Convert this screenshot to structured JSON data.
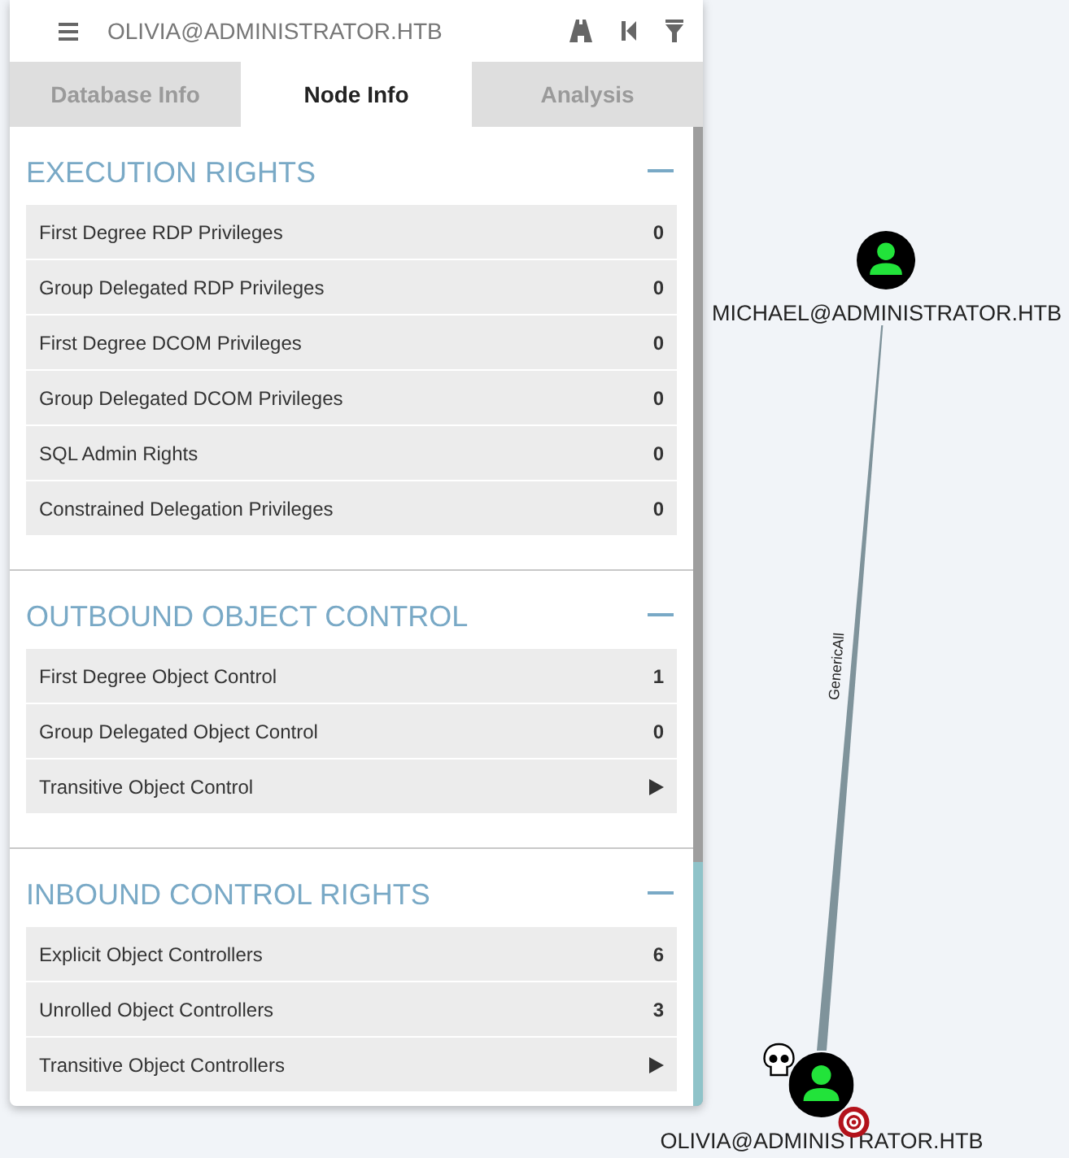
{
  "header": {
    "title": "OLIVIA@ADMINISTRATOR.HTB"
  },
  "tabs": [
    {
      "label": "Database Info",
      "selected": false
    },
    {
      "label": "Node Info",
      "selected": true
    },
    {
      "label": "Analysis",
      "selected": false
    }
  ],
  "sections": [
    {
      "title": "EXECUTION RIGHTS",
      "expanded": true,
      "rows": [
        {
          "kind": "count",
          "label": "First Degree RDP Privileges",
          "value": "0"
        },
        {
          "kind": "count",
          "label": "Group Delegated RDP Privileges",
          "value": "0"
        },
        {
          "kind": "count",
          "label": "First Degree DCOM Privileges",
          "value": "0"
        },
        {
          "kind": "count",
          "label": "Group Delegated DCOM Privileges",
          "value": "0"
        },
        {
          "kind": "count",
          "label": "SQL Admin Rights",
          "value": "0"
        },
        {
          "kind": "count",
          "label": "Constrained Delegation Privileges",
          "value": "0"
        }
      ]
    },
    {
      "title": "OUTBOUND OBJECT CONTROL",
      "expanded": true,
      "rows": [
        {
          "kind": "count",
          "label": "First Degree Object Control",
          "value": "1"
        },
        {
          "kind": "count",
          "label": "Group Delegated Object Control",
          "value": "0"
        },
        {
          "kind": "expand",
          "label": "Transitive Object Control"
        }
      ]
    },
    {
      "title": "INBOUND CONTROL RIGHTS",
      "expanded": true,
      "rows": [
        {
          "kind": "count",
          "label": "Explicit Object Controllers",
          "value": "6"
        },
        {
          "kind": "count",
          "label": "Unrolled Object Controllers",
          "value": "3"
        },
        {
          "kind": "expand",
          "label": "Transitive Object Controllers"
        }
      ]
    }
  ],
  "graph": {
    "nodes": [
      {
        "kind": "user",
        "label": "MICHAEL@ADMINISTRATOR.HTB",
        "owned": false,
        "high_value": false
      },
      {
        "kind": "user",
        "label": "OLIVIA@ADMINISTRATOR.HTB",
        "owned": true,
        "high_value": true
      }
    ],
    "edges": [
      {
        "label": "GenericAll"
      }
    ]
  }
}
